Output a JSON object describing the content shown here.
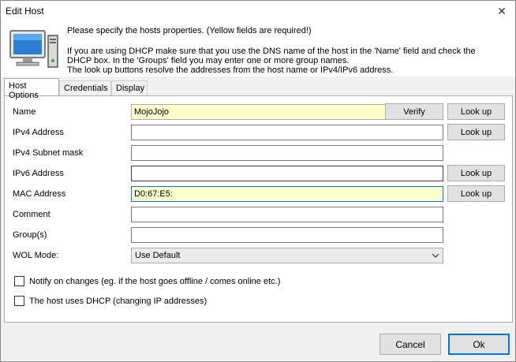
{
  "window": {
    "title": "Edit Host",
    "close_glyph": "✕"
  },
  "header": {
    "icon": "computer-icon",
    "intro_required": "Please specify the hosts properties. (Yellow fields are required!)",
    "intro_dhcp_1": "If you are using DHCP make sure that you use the DNS name of the host in the 'Name' field and check the",
    "intro_dhcp_2": "DHCP box. In the 'Groups' field you may enter one or more group names.",
    "intro_dhcp_3": "The look up buttons resolve the addresses from the host name or IPv4/IPv6 address."
  },
  "tabs": [
    {
      "label": "Host Options",
      "active": true
    },
    {
      "label": "Credentials",
      "active": false
    },
    {
      "label": "Display",
      "active": false
    }
  ],
  "form": {
    "name": {
      "label": "Name",
      "value": "MojoJojo",
      "required": true
    },
    "ipv4": {
      "label": "IPv4 Address",
      "value": ""
    },
    "subnet": {
      "label": "IPv4 Subnet mask",
      "value": ""
    },
    "ipv6": {
      "label": "IPv6 Address",
      "value": ""
    },
    "mac": {
      "label": "MAC Address",
      "value": "D0:67:E5:",
      "required": true
    },
    "comment": {
      "label": "Comment",
      "value": ""
    },
    "groups": {
      "label": "Group(s)",
      "value": ""
    },
    "wol": {
      "label": "WOL Mode:",
      "value": "Use Default"
    }
  },
  "buttons": {
    "verify": "Verify",
    "lookup": "Look up",
    "cancel": "Cancel",
    "ok": "Ok"
  },
  "checkboxes": {
    "notify": {
      "label": "Notify on changes (eg. if the host goes offline / comes online etc.)",
      "checked": false
    },
    "dhcp": {
      "label": "The host uses DHCP (changing IP addresses)",
      "checked": false
    }
  },
  "colors": {
    "required_field": "#ffffcc",
    "focus_border": "#0078d7"
  }
}
